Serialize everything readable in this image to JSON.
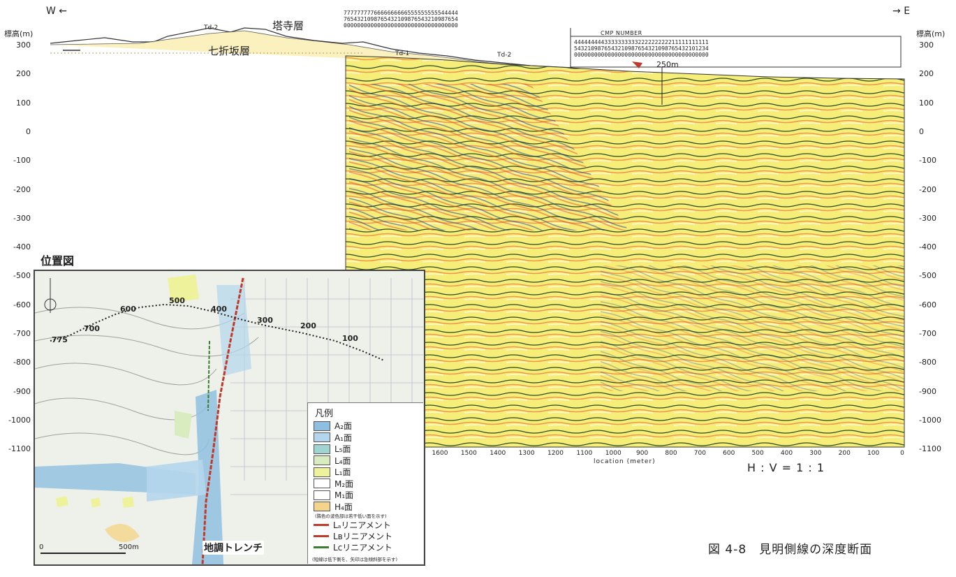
{
  "header": {
    "west": "W",
    "east": "E",
    "elev_label_left": "標高(m)",
    "elev_label_right": "標高(m)",
    "formation_top": "塔寺層",
    "formation_bottom": "七折坂層",
    "td2_left": "Td-2",
    "td1": "Td-1",
    "td2_right": "Td-2",
    "cmp_number": "CMP NUMBER",
    "marker_250": "250m"
  },
  "axes": {
    "y_ticks": [
      "300",
      "200",
      "100",
      "0",
      "-100",
      "-200",
      "-300",
      "-400",
      "-500",
      "-600",
      "-700",
      "-800",
      "-900",
      "-1000",
      "-1100"
    ],
    "x_ticks": [
      "1600",
      "1500",
      "1400",
      "1300",
      "1200",
      "1100",
      "1000",
      "900",
      "800",
      "700",
      "600",
      "500",
      "400",
      "300",
      "200",
      "100",
      "0"
    ],
    "x_label": "location (meter)",
    "scale_ratio": "H : V = 1 : 1"
  },
  "cmp": {
    "row1": "7777777776666666666555555555544444",
    "row2": "7654321098765432109876543210987654",
    "row3": "0000000000000000000000000000000000",
    "row4": "4444444443333333333222222222211111111111",
    "row5": "5432109876543210987654321098765432101234",
    "row6": "0000000000000000000000000000000000000000"
  },
  "inset": {
    "title": "位置図",
    "route_labels": [
      "775",
      "700",
      "600",
      "500",
      "400",
      "300",
      "200",
      "100"
    ],
    "scale_zero": "0",
    "scale_500": "500m",
    "trench": "地調トレンチ",
    "legend_title": "凡例",
    "legend_items": [
      {
        "label": "A₂面",
        "color": "#8fbfe0"
      },
      {
        "label": "A₁面",
        "color": "#b4d6ec"
      },
      {
        "label": "L₅面",
        "color": "#9fd4d0"
      },
      {
        "label": "L₄面",
        "color": "#d8ecc0"
      },
      {
        "label": "L₁面",
        "color": "#eef29a"
      },
      {
        "label": "M₂面",
        "color": "#ffffff"
      },
      {
        "label": "M₁面",
        "color": "#ffffff"
      },
      {
        "label": "H₄面",
        "color": "#f4d48a"
      }
    ],
    "legend_note": "(隣色の波色部は若干低い面を示す)",
    "lineaments": [
      {
        "label": "Lₐリニアメント",
        "color": "#c0392b"
      },
      {
        "label": "Lʙリニアメント",
        "color": "#c0392b"
      },
      {
        "label": "Lᴄリニアメント",
        "color": "#3a7d2e"
      }
    ],
    "legend_note2": "(短線は低下側を、矢印は急傾斜部を示す)"
  },
  "caption": "図 4-8　見明側線の深度断面"
}
